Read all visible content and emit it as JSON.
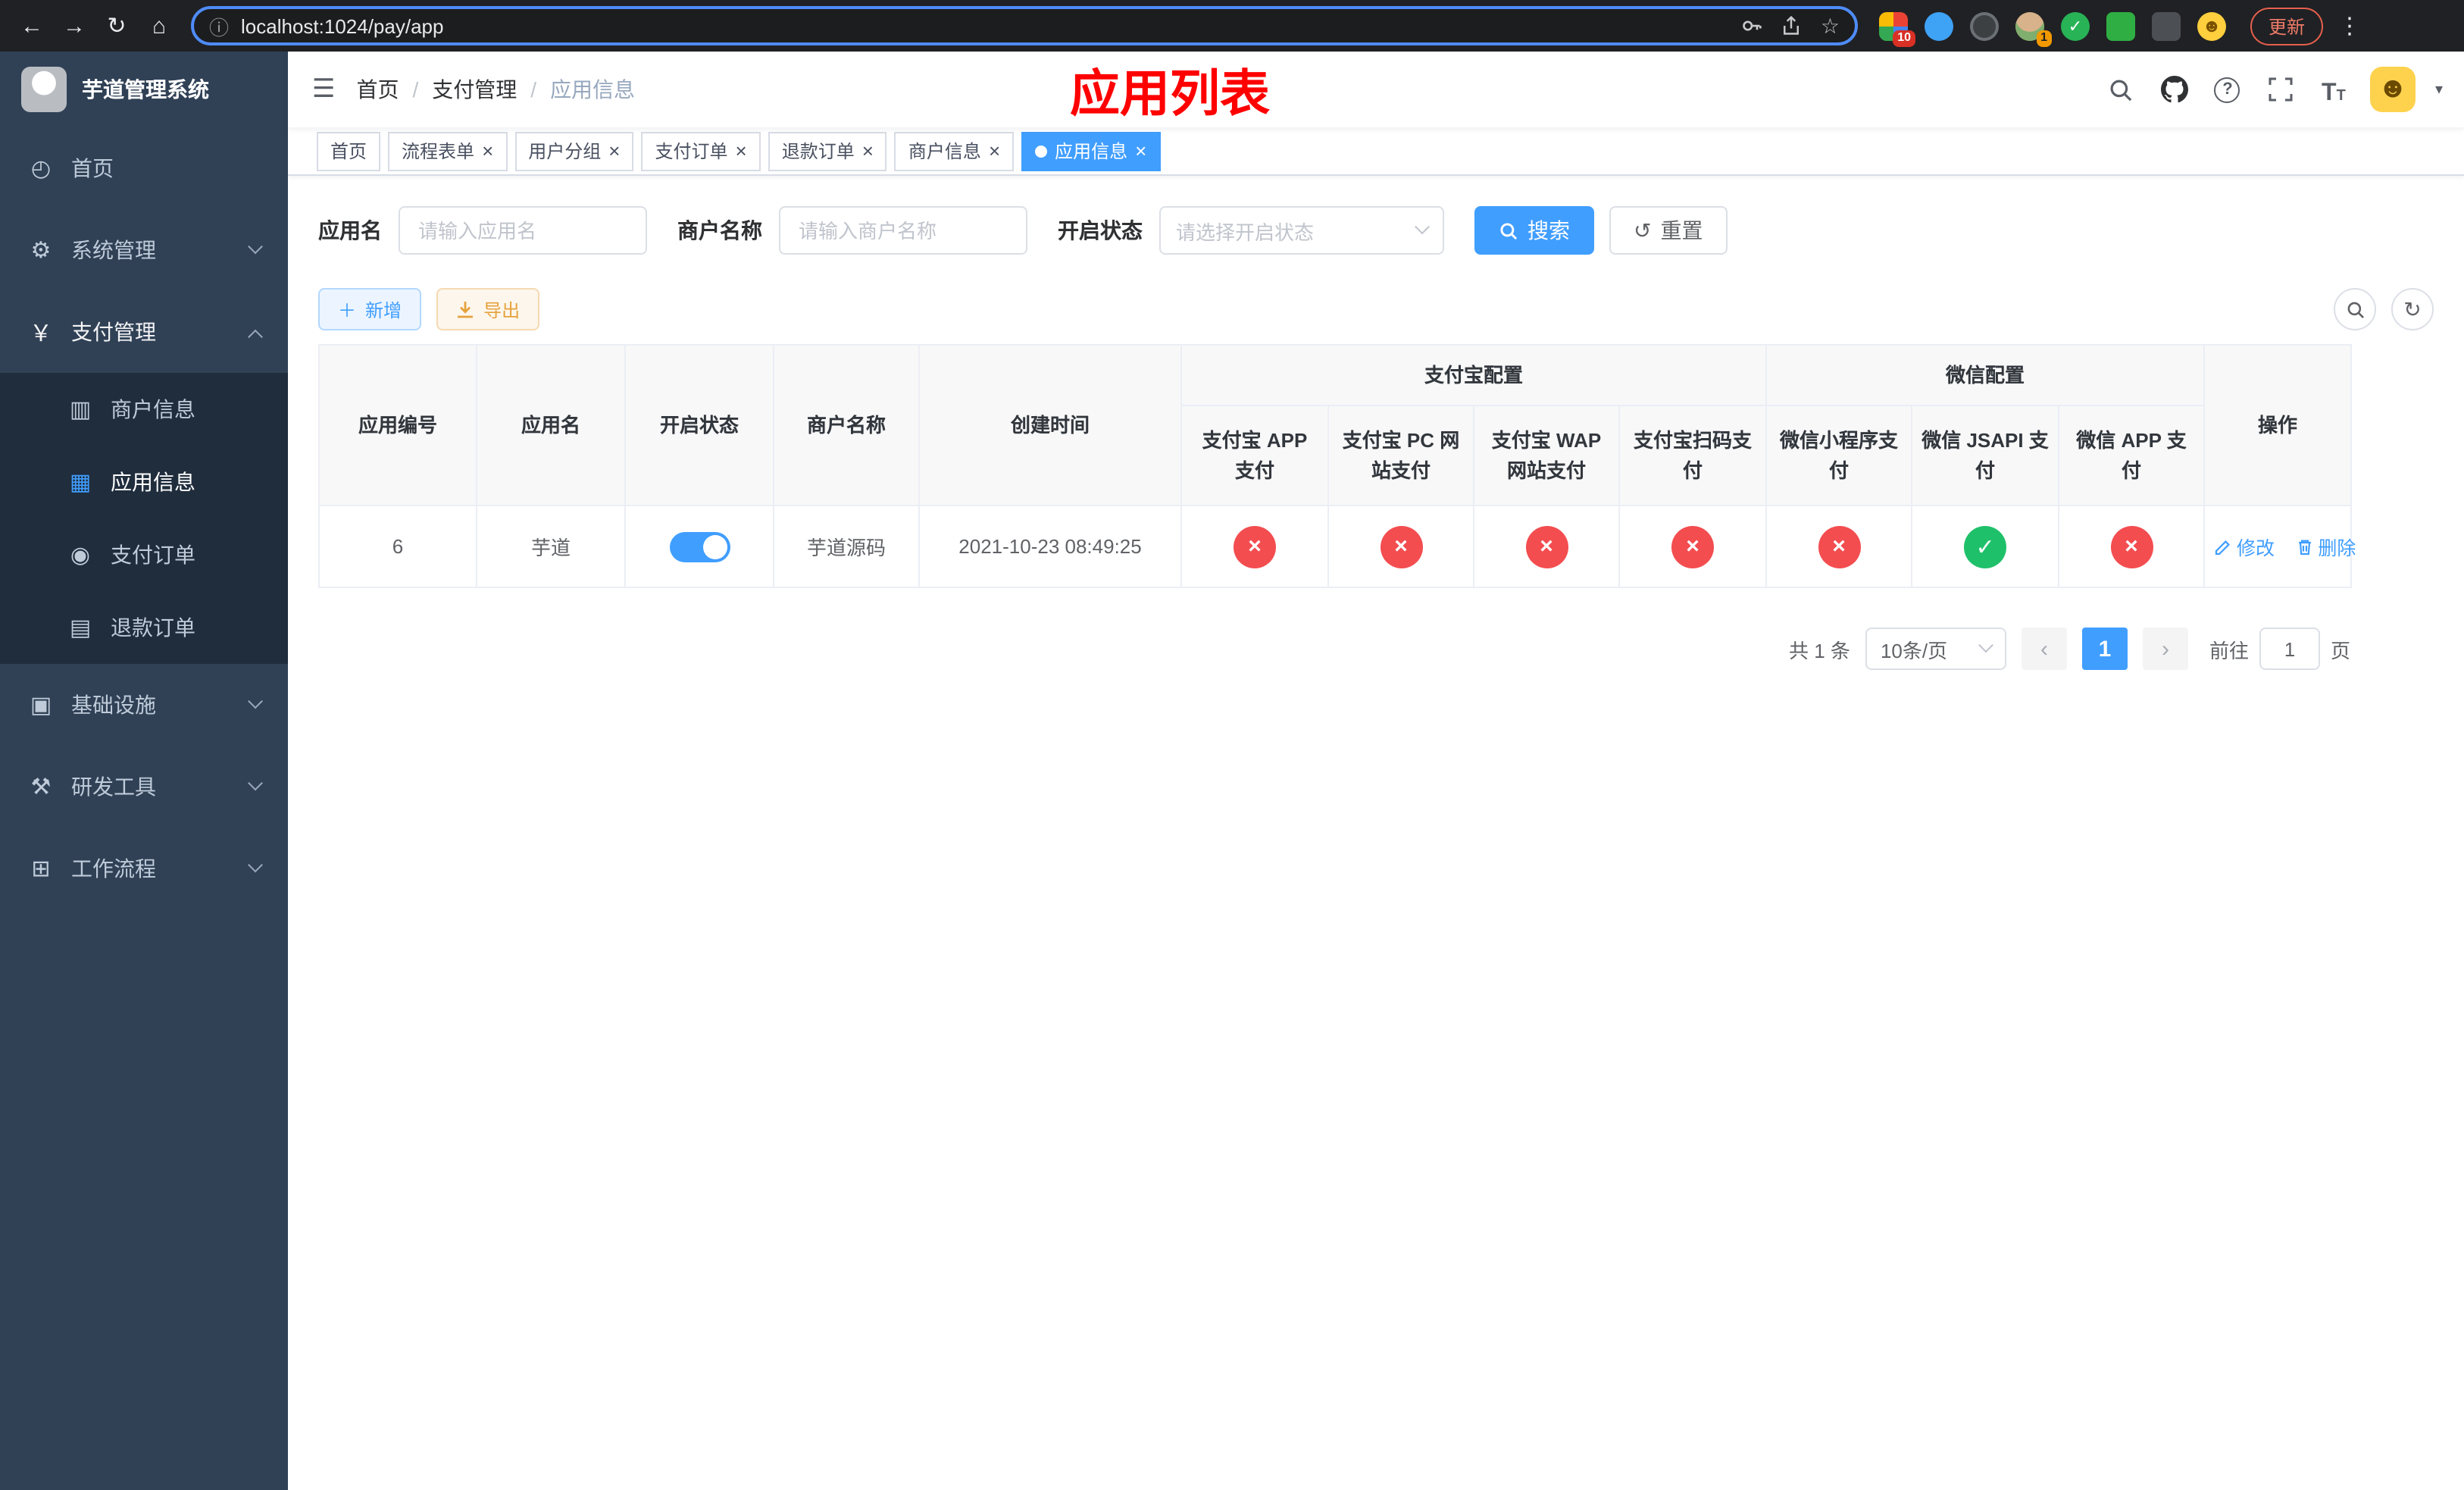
{
  "browser": {
    "url": "localhost:1024/pay/app",
    "update_label": "更新",
    "ext_badge_1": "10",
    "ext_badge_2": "1"
  },
  "sidebar": {
    "title": "芋道管理系统",
    "home": "首页",
    "system": "系统管理",
    "payment": "支付管理",
    "merchant_info": "商户信息",
    "app_info": "应用信息",
    "pay_order": "支付订单",
    "refund_order": "退款订单",
    "infra": "基础设施",
    "dev_tools": "研发工具",
    "workflow": "工作流程"
  },
  "navbar": {
    "breadcrumb": [
      "首页",
      "支付管理",
      "应用信息"
    ],
    "page_title": "应用列表"
  },
  "tags": {
    "items": [
      {
        "label": "首页",
        "closable": false,
        "active": false
      },
      {
        "label": "流程表单",
        "closable": true,
        "active": false
      },
      {
        "label": "用户分组",
        "closable": true,
        "active": false
      },
      {
        "label": "支付订单",
        "closable": true,
        "active": false
      },
      {
        "label": "退款订单",
        "closable": true,
        "active": false
      },
      {
        "label": "商户信息",
        "closable": true,
        "active": false
      },
      {
        "label": "应用信息",
        "closable": true,
        "active": true
      }
    ]
  },
  "filters": {
    "app_name_label": "应用名",
    "app_name_placeholder": "请输入应用名",
    "merchant_label": "商户名称",
    "merchant_placeholder": "请输入商户名称",
    "status_label": "开启状态",
    "status_placeholder": "请选择开启状态",
    "search_label": "搜索",
    "reset_label": "重置"
  },
  "toolbar": {
    "add_label": "新增",
    "export_label": "导出"
  },
  "table": {
    "headers": {
      "app_id": "应用编号",
      "app_name": "应用名",
      "status": "开启状态",
      "merchant": "商户名称",
      "created": "创建时间",
      "alipay_group": "支付宝配置",
      "alipay_cols": [
        "支付宝 APP 支付",
        "支付宝 PC 网站支付",
        "支付宝 WAP 网站支付",
        "支付宝扫码支付"
      ],
      "wechat_group": "微信配置",
      "wechat_cols": [
        "微信小程序支付",
        "微信 JSAPI 支付",
        "微信 APP 支付"
      ],
      "actions": "操作"
    },
    "rows": [
      {
        "app_id": "6",
        "app_name": "芋道",
        "enabled": "on",
        "merchant": "芋道源码",
        "created": "2021-10-23 08:49:25",
        "alipay": [
          "no",
          "no",
          "no",
          "no"
        ],
        "wechat": [
          "no",
          "yes",
          "no"
        ],
        "edit_label": "修改",
        "delete_label": "删除"
      }
    ]
  },
  "pagination": {
    "total": "共 1 条",
    "page_size": "10条/页",
    "current_page": "1",
    "goto_label": "前往",
    "goto_value": "1",
    "page_unit": "页"
  }
}
